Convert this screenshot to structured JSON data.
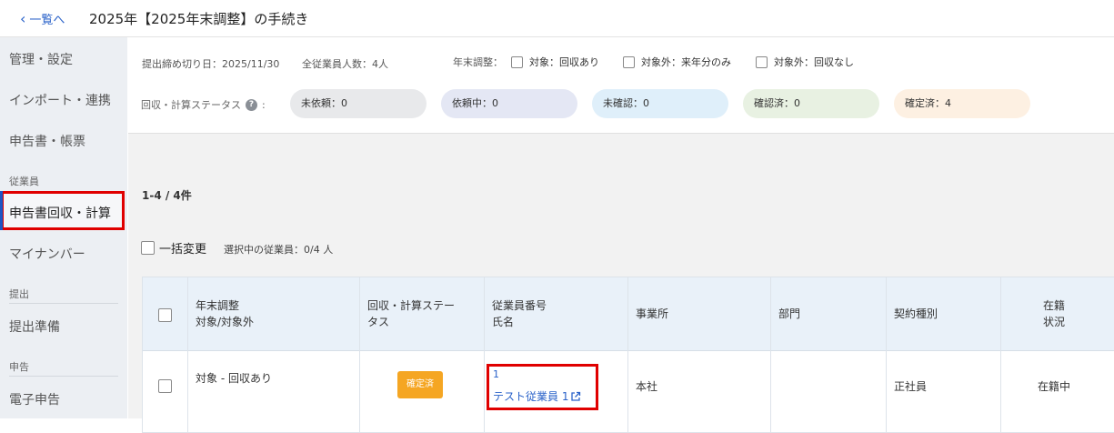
{
  "header": {
    "back_label": "一覧へ",
    "title": "2025年【2025年末調整】の手続き"
  },
  "sidebar": {
    "items_top": [
      "管理・設定",
      "インポート・連携",
      "申告書・帳票"
    ],
    "section_employee": "従業員",
    "active_item": "申告書回収・計算",
    "item_mynumber": "マイナンバー",
    "section_submit": "提出",
    "item_submit_prep": "提出準備",
    "section_filing": "申告",
    "item_efiling": "電子申告"
  },
  "filters": {
    "deadline": "提出締め切り日：2025/11/30",
    "employee_total": "全従業員人数：4人",
    "year_end_label": "年末調整：",
    "options": [
      "対象：回収あり",
      "対象外：来年分のみ",
      "対象外：回収なし"
    ],
    "status_label": "回収・計算ステータス",
    "status_colon": ":",
    "help_glyph": "?",
    "statuses": [
      {
        "label": "未依頼：0",
        "color": "#e8e9eb"
      },
      {
        "label": "依頼中：0",
        "color": "#e4e7f4"
      },
      {
        "label": "未確認：0",
        "color": "#dfeffa"
      },
      {
        "label": "確認済：0",
        "color": "#e8f1e2"
      },
      {
        "label": "確定済：4",
        "color": "#fdf0e2"
      }
    ]
  },
  "list": {
    "count": "1-4 / 4件",
    "bulk_change": "一括変更",
    "selected": "選択中の従業員：0/4 人"
  },
  "table": {
    "headers": {
      "year_end_1": "年末調整",
      "year_end_2": "対象/対象外",
      "status_1": "回収・計算ステー",
      "status_2": "タス",
      "employee_1": "従業員番号",
      "employee_2": "氏名",
      "office": "事業所",
      "dept": "部門",
      "contract": "契約種別",
      "enroll_1": "在籍",
      "enroll_2": "状況"
    },
    "rows": [
      {
        "year_end": "対象 - 回収あり",
        "status": "確定済",
        "employee_number": "1",
        "employee_name": "テスト従業員 1",
        "office": "本社",
        "dept": "",
        "contract": "正社員",
        "enrollment": "在籍中"
      }
    ]
  },
  "colors": {
    "accent": "#2a62c9",
    "highlight": "#e00000",
    "badge": "#f5a623",
    "sidebar_bg": "#eceff3",
    "table_header_bg": "#e9f1f9"
  },
  "icons": {
    "back": "chevron-left-icon",
    "help": "question-circle-icon",
    "external": "external-link-icon"
  }
}
